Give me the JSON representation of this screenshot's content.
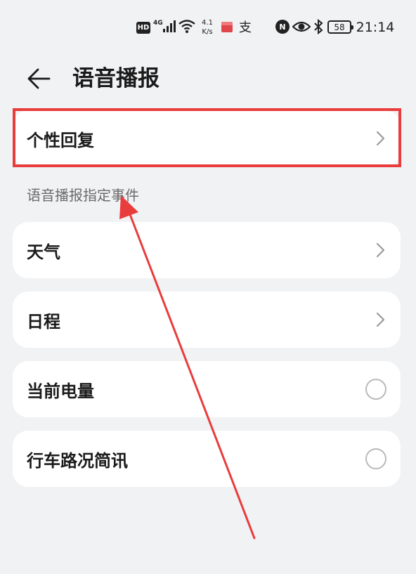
{
  "status_bar": {
    "hd": "HD",
    "network": "4G",
    "speed_value": "4.1",
    "speed_unit": "K/s",
    "app_icon_2": "支",
    "battery": "58",
    "time": "21:14"
  },
  "header": {
    "title": "语音播报",
    "back_icon": "arrow-left-icon"
  },
  "personal_reply": {
    "label": "个性回复",
    "icon": "chevron-right-icon"
  },
  "section_header": "语音播报指定事件",
  "events": [
    {
      "label": "天气",
      "control": "chevron"
    },
    {
      "label": "日程",
      "control": "chevron"
    },
    {
      "label": "当前电量",
      "control": "radio",
      "checked": false
    },
    {
      "label": "行车路况简讯",
      "control": "radio",
      "checked": false
    }
  ],
  "colors": {
    "background": "#f1f2f4",
    "card": "#ffffff",
    "highlight": "#e93c3c",
    "annotation_arrow": "#e93c3c"
  }
}
